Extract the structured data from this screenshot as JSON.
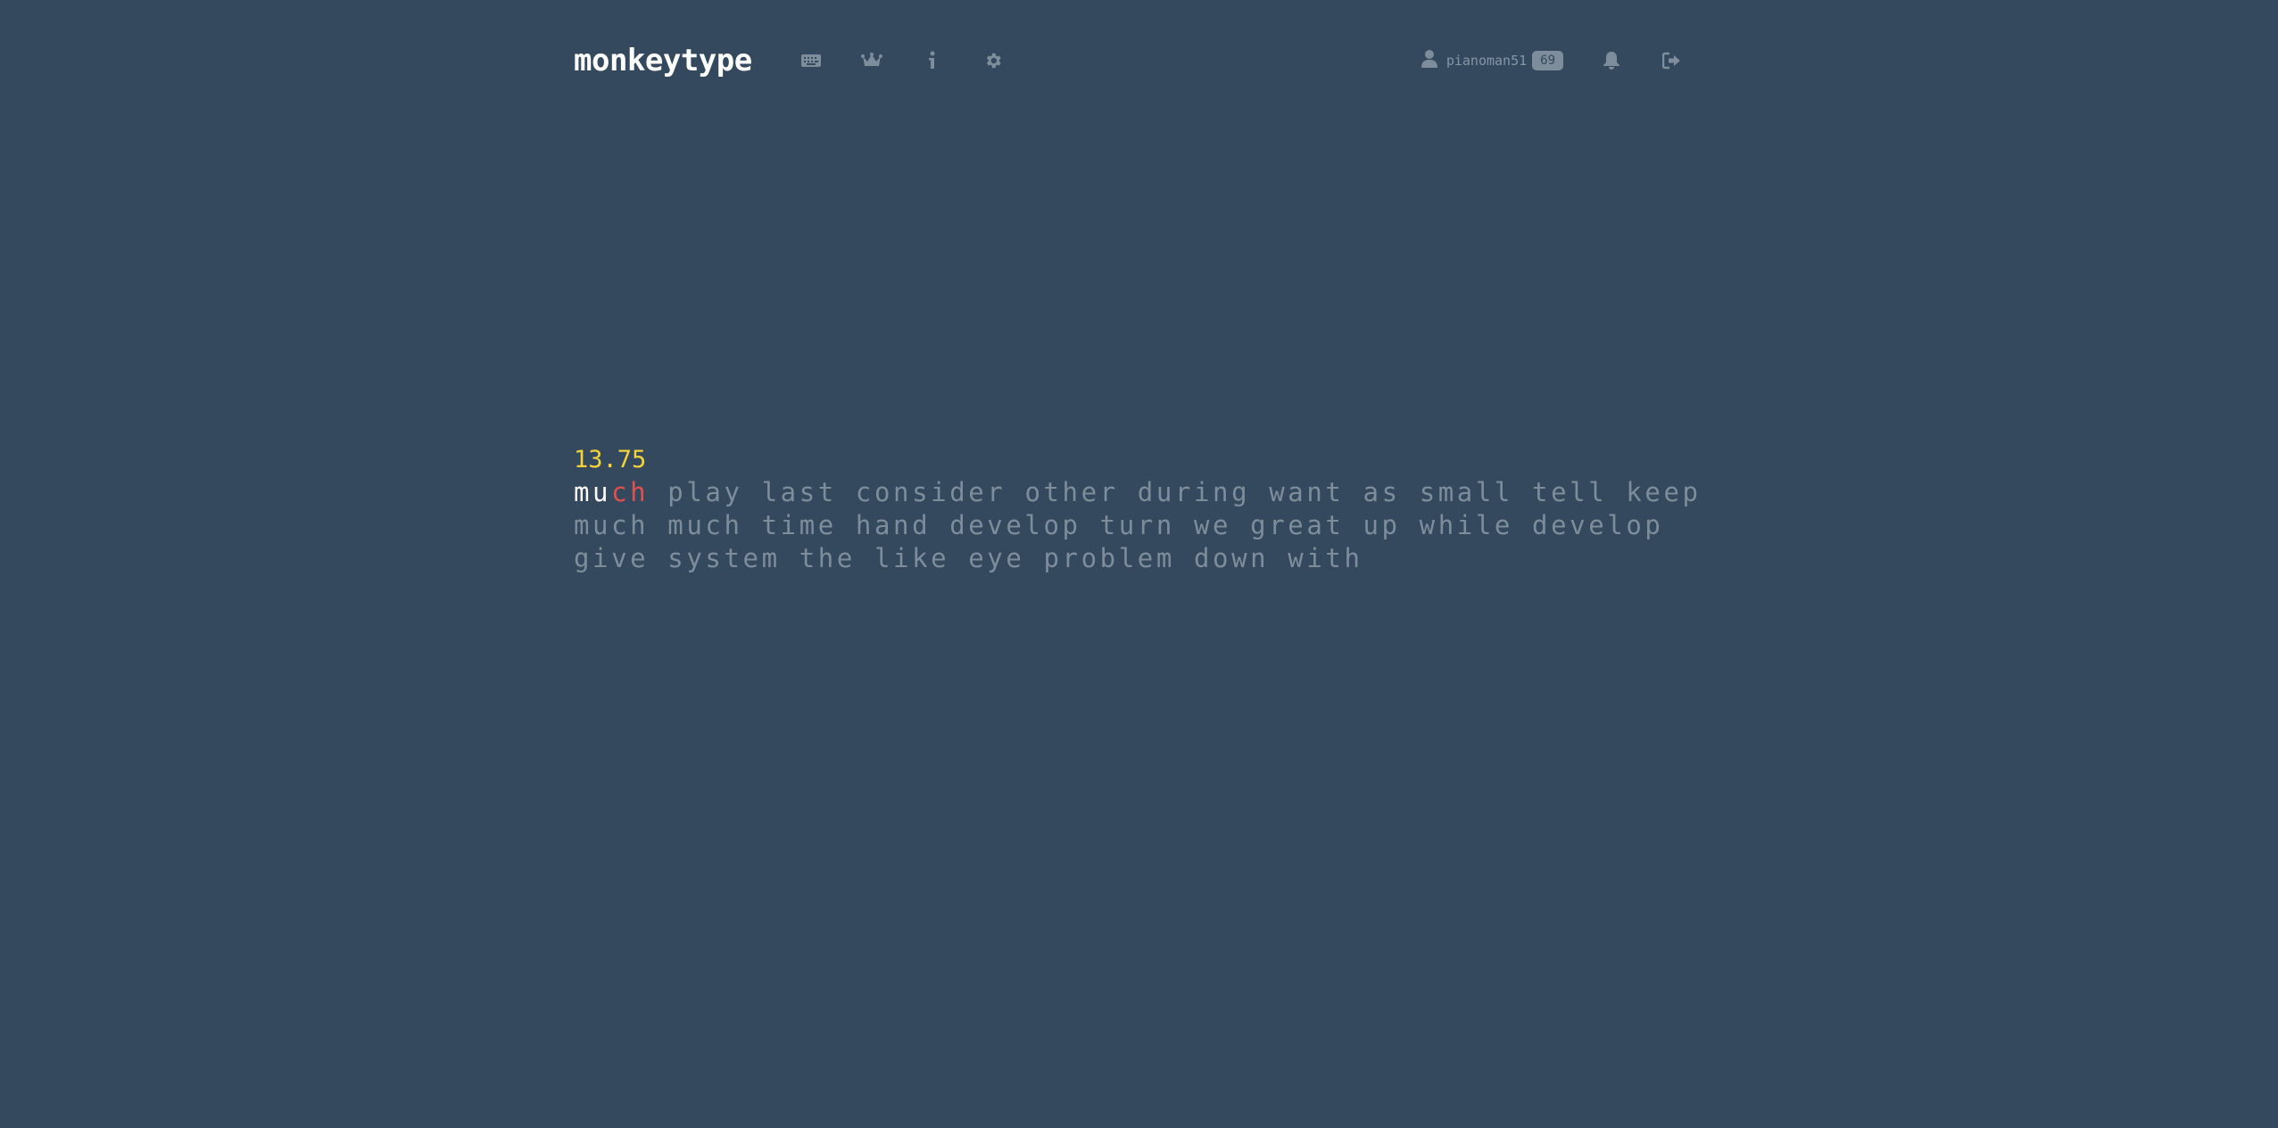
{
  "header": {
    "logo": "monkeytype",
    "nav_icons": [
      "keyboard-icon",
      "crown-icon",
      "info-icon",
      "gear-icon"
    ],
    "account": {
      "username": "pianoman51",
      "level": "69"
    },
    "right_icons": [
      "bell-icon",
      "sign-out-icon"
    ]
  },
  "test": {
    "live_speed": "13.75",
    "active_word": {
      "correct": "mu",
      "error": "ch"
    },
    "line1_rest": " play last consider other during want as small tell keep",
    "line2": "much much time hand develop turn we great up while develop",
    "line3": "give system the like eye problem down with"
  },
  "colors": {
    "background": "#34495e",
    "text_untyped": "#7d8d9c",
    "text_correct": "#ffffff",
    "text_error": "#e2504d",
    "accent_speed": "#f4d23a"
  }
}
